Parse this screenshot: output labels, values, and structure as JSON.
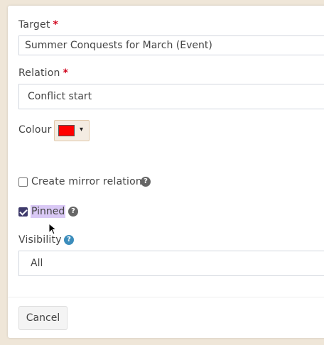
{
  "form": {
    "target": {
      "label": "Target",
      "required_mark": "*",
      "value": "Summer Conquests for March (Event)"
    },
    "relation": {
      "label": "Relation",
      "required_mark": "*",
      "value": "Conflict start"
    },
    "colour": {
      "label": "Colour",
      "swatch_color": "#ff0000",
      "caret": "▾"
    },
    "mirror": {
      "label": "Create mirror relation",
      "checked": false,
      "help": "?"
    },
    "pinned": {
      "label": "Pinned",
      "checked": true,
      "help": "?"
    },
    "visibility": {
      "label": "Visibility",
      "value": "All",
      "help": "?"
    }
  },
  "footer": {
    "cancel_label": "Cancel"
  },
  "colors": {
    "accent": "#3e3a6b",
    "required": "#d0021b",
    "help_blue": "#3c8dbc"
  }
}
